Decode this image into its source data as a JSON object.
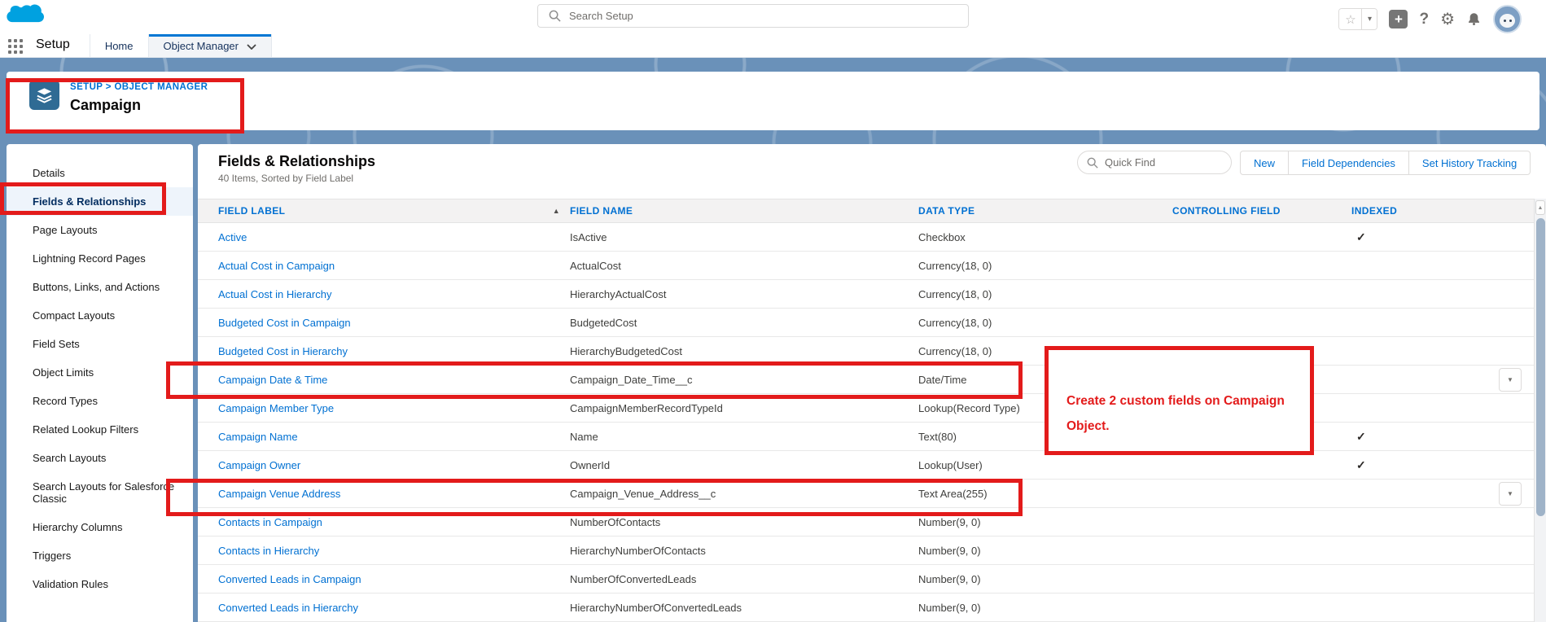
{
  "global_header": {
    "search": {
      "placeholder": "Search Setup"
    },
    "icons": [
      "favorites-star-icon",
      "favorites-caret-icon",
      "add-icon",
      "help-icon",
      "setup-gear-icon",
      "notifications-bell-icon",
      "user-avatar"
    ]
  },
  "nav": {
    "app_label": "Setup",
    "tabs": [
      {
        "label": "Home",
        "active": false
      },
      {
        "label": "Object Manager",
        "active": true,
        "has_dropdown": true
      }
    ]
  },
  "page_header": {
    "breadcrumb": "SETUP > OBJECT MANAGER",
    "title": "Campaign"
  },
  "sidebar": {
    "active_item": "Fields & Relationships",
    "items": [
      "Details",
      "Fields & Relationships",
      "Page Layouts",
      "Lightning Record Pages",
      "Buttons, Links, and Actions",
      "Compact Layouts",
      "Field Sets",
      "Object Limits",
      "Record Types",
      "Related Lookup Filters",
      "Search Layouts",
      "Search Layouts for Salesforce Classic",
      "Hierarchy Columns",
      "Triggers",
      "Validation Rules"
    ]
  },
  "main": {
    "heading": "Fields & Relationships",
    "subheading": "40 Items, Sorted by Field Label",
    "quick_find_placeholder": "Quick Find",
    "buttons": {
      "new": "New",
      "field_dependencies": "Field Dependencies",
      "set_history_tracking": "Set History Tracking"
    },
    "table": {
      "columns": [
        "FIELD LABEL",
        "FIELD NAME",
        "DATA TYPE",
        "CONTROLLING FIELD",
        "INDEXED"
      ],
      "sorted_column": "FIELD LABEL",
      "rows": [
        {
          "label": "Active",
          "name": "IsActive",
          "type": "Checkbox",
          "controlling": "",
          "indexed": true,
          "menu": false,
          "red_boxed": false
        },
        {
          "label": "Actual Cost in Campaign",
          "name": "ActualCost",
          "type": "Currency(18, 0)",
          "controlling": "",
          "indexed": false,
          "menu": false,
          "red_boxed": false
        },
        {
          "label": "Actual Cost in Hierarchy",
          "name": "HierarchyActualCost",
          "type": "Currency(18, 0)",
          "controlling": "",
          "indexed": false,
          "menu": false,
          "red_boxed": false
        },
        {
          "label": "Budgeted Cost in Campaign",
          "name": "BudgetedCost",
          "type": "Currency(18, 0)",
          "controlling": "",
          "indexed": false,
          "menu": false,
          "red_boxed": false
        },
        {
          "label": "Budgeted Cost in Hierarchy",
          "name": "HierarchyBudgetedCost",
          "type": "Currency(18, 0)",
          "controlling": "",
          "indexed": false,
          "menu": false,
          "red_boxed": false
        },
        {
          "label": "Campaign Date & Time",
          "name": "Campaign_Date_Time__c",
          "type": "Date/Time",
          "controlling": "",
          "indexed": false,
          "menu": true,
          "red_boxed": true
        },
        {
          "label": "Campaign Member Type",
          "name": "CampaignMemberRecordTypeId",
          "type": "Lookup(Record Type)",
          "controlling": "",
          "indexed": false,
          "menu": false,
          "red_boxed": false
        },
        {
          "label": "Campaign Name",
          "name": "Name",
          "type": "Text(80)",
          "controlling": "",
          "indexed": true,
          "menu": false,
          "red_boxed": false
        },
        {
          "label": "Campaign Owner",
          "name": "OwnerId",
          "type": "Lookup(User)",
          "controlling": "",
          "indexed": true,
          "menu": false,
          "red_boxed": false
        },
        {
          "label": "Campaign Venue Address",
          "name": "Campaign_Venue_Address__c",
          "type": "Text Area(255)",
          "controlling": "",
          "indexed": false,
          "menu": true,
          "red_boxed": true
        },
        {
          "label": "Contacts in Campaign",
          "name": "NumberOfContacts",
          "type": "Number(9, 0)",
          "controlling": "",
          "indexed": false,
          "menu": false,
          "red_boxed": false
        },
        {
          "label": "Contacts in Hierarchy",
          "name": "HierarchyNumberOfContacts",
          "type": "Number(9, 0)",
          "controlling": "",
          "indexed": false,
          "menu": false,
          "red_boxed": false
        },
        {
          "label": "Converted Leads in Campaign",
          "name": "NumberOfConvertedLeads",
          "type": "Number(9, 0)",
          "controlling": "",
          "indexed": false,
          "menu": false,
          "red_boxed": false
        },
        {
          "label": "Converted Leads in Hierarchy",
          "name": "HierarchyNumberOfConvertedLeads",
          "type": "Number(9, 0)",
          "controlling": "",
          "indexed": false,
          "menu": false,
          "red_boxed": false
        }
      ]
    }
  },
  "annotation": {
    "text": "Create 2 custom fields on Campaign Object."
  },
  "icons": {
    "check": "✓",
    "menu_arrow": "▼",
    "sort_asc": "▲",
    "scroll_up": "▲",
    "star": "☆",
    "caret": "▾",
    "plus": "+",
    "question": "?",
    "gear": "⚙"
  },
  "colors": {
    "link_blue": "#0070d2",
    "annotation_red": "#e31b1b",
    "band_blue": "#6a91b9",
    "brand_cloud": "#00a1e0",
    "active_tab_bar": "#0176d3"
  }
}
